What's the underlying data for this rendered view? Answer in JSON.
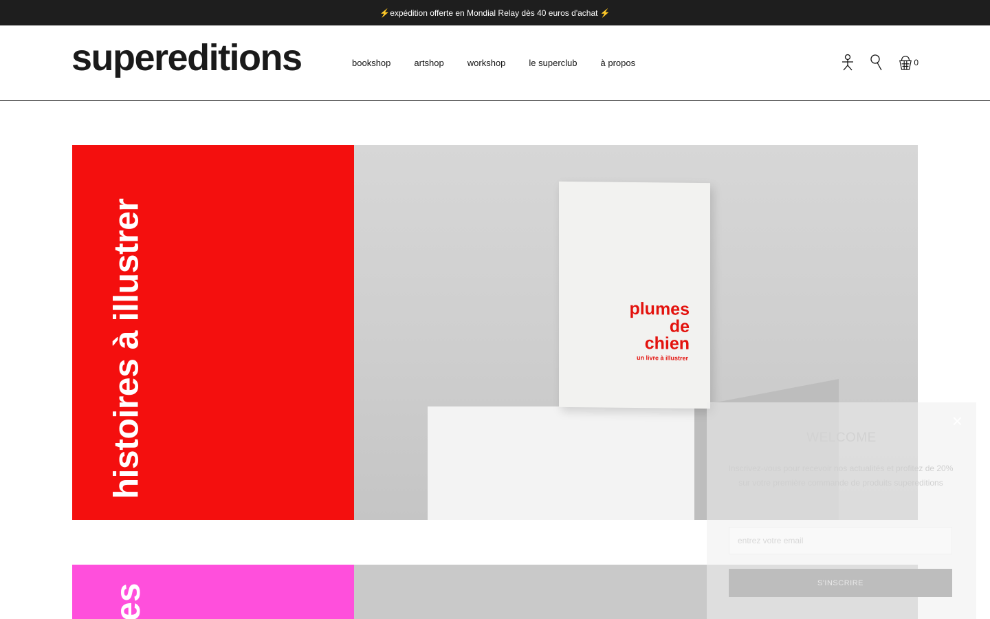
{
  "announcement": "⚡expédition offerte en Mondial Relay dès 40 euros d'achat ⚡",
  "header": {
    "logo": "supereditions",
    "nav": [
      "bookshop",
      "artshop",
      "workshop",
      "le superclub",
      "à propos"
    ],
    "cart_count": "0",
    "icons": [
      "account-icon",
      "search-icon",
      "cart-icon"
    ]
  },
  "hero": {
    "vertical_title": "histoires à illustrer",
    "accent_color": "#f40f0e",
    "book": {
      "title_lines": [
        "plumes",
        "de",
        "chien"
      ],
      "subtitle": "un livre à illustrer"
    }
  },
  "hero2": {
    "vertical_title": "es",
    "accent_color": "#ff4fdc"
  },
  "popup": {
    "title": "WELCOME",
    "text": "Inscrivez-vous pour recevoir nos actualités et profitez de 20% sur votre première commande de produits supereditions",
    "email_placeholder": "entrez votre email",
    "submit": "S'INSCRIRE",
    "close": "×"
  }
}
